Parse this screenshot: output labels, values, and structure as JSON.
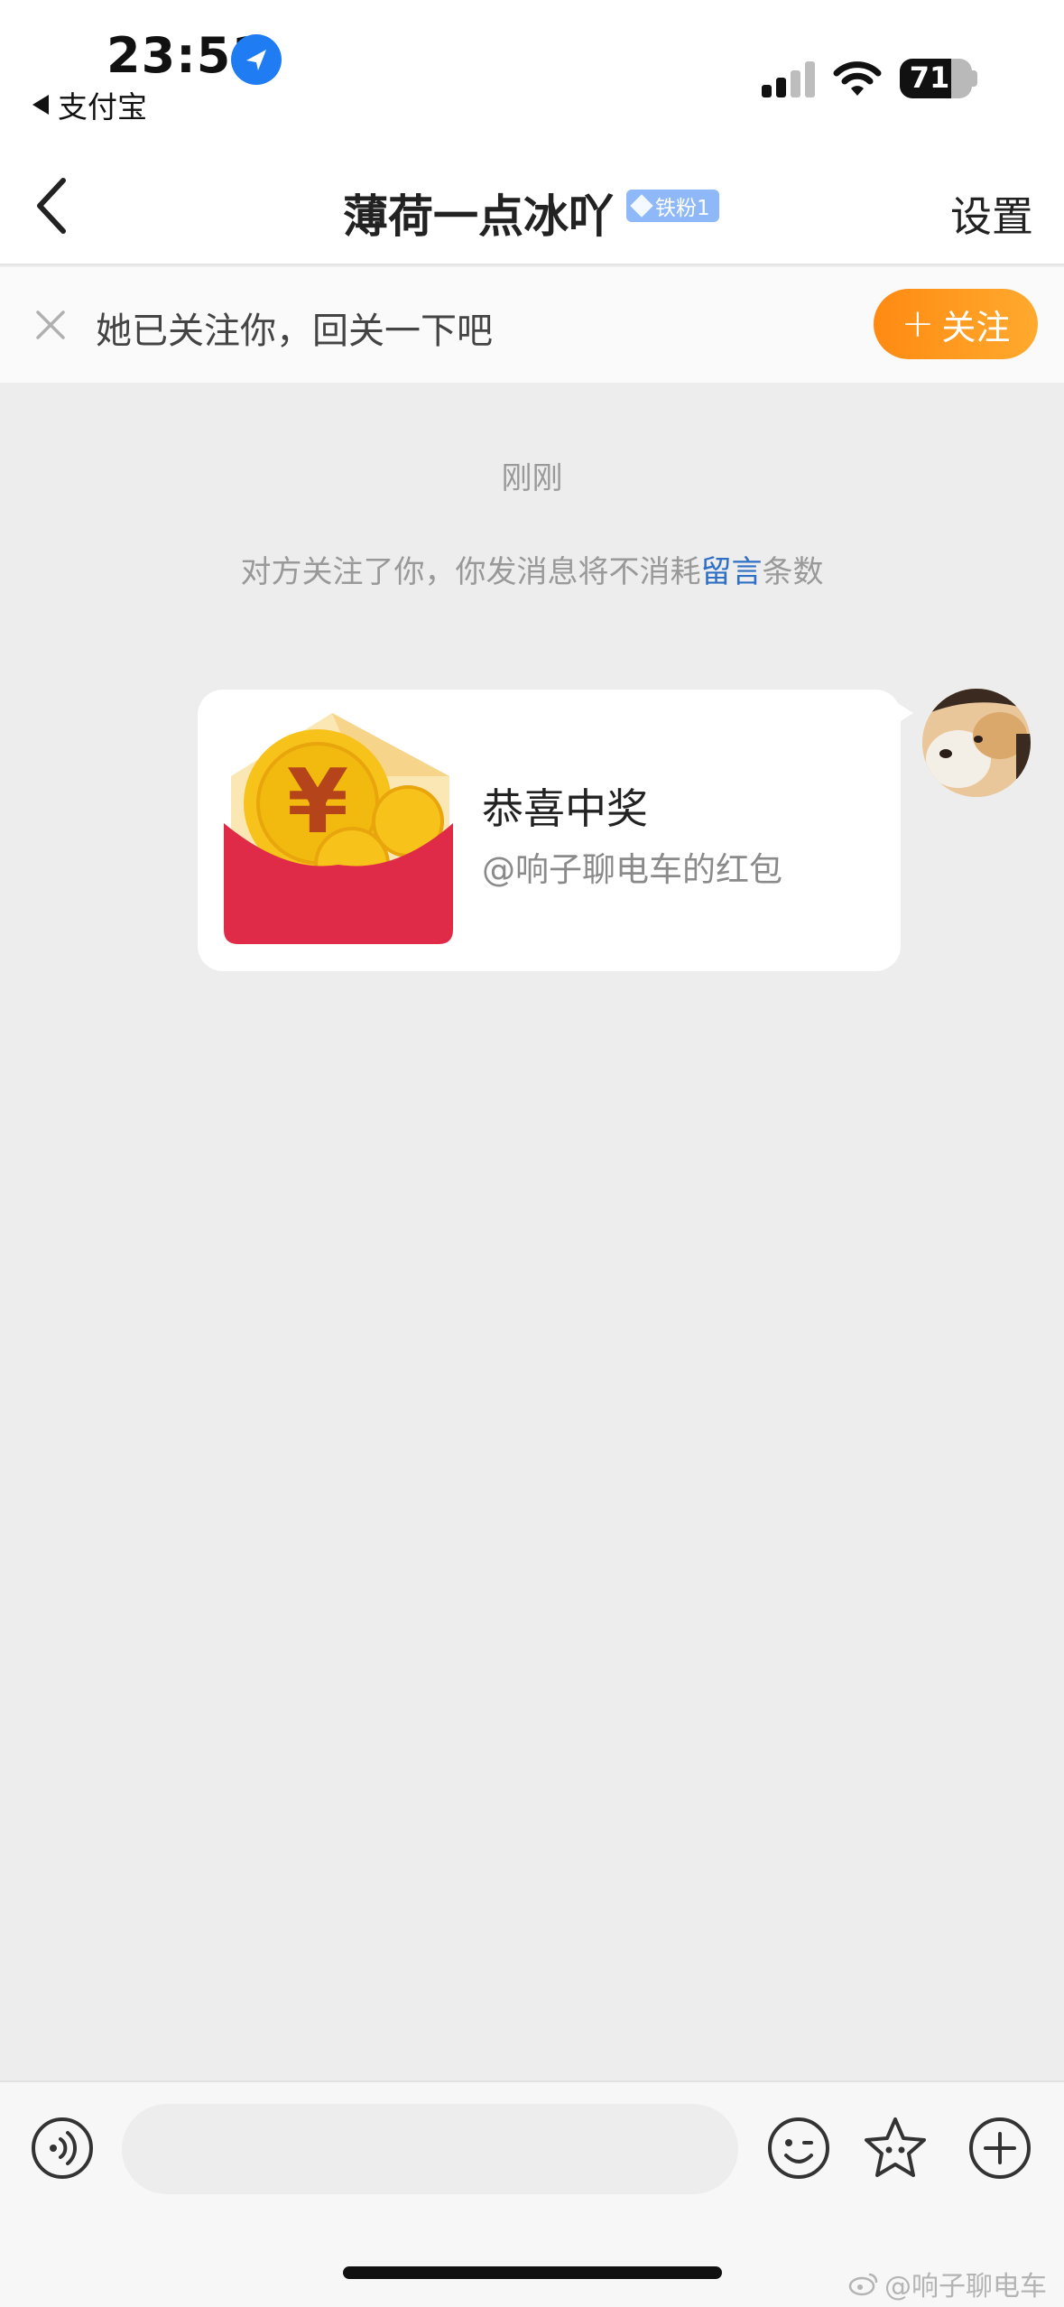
{
  "status_bar": {
    "time": "23:51",
    "back_app": "支付宝",
    "battery": "71",
    "icons": {
      "location": "location-arrow-icon",
      "signal": "cell-signal-icon",
      "wifi": "wifi-icon",
      "battery": "battery-icon"
    }
  },
  "nav": {
    "back_icon": "chevron-left-icon",
    "title": "薄荷一点冰吖",
    "badge": "铁粉1",
    "settings": "设置"
  },
  "banner": {
    "close_icon": "close-icon",
    "text": "她已关注你，回关一下吧",
    "follow_button": "关注",
    "follow_button_prefix": "+"
  },
  "chat": {
    "timestamp": "刚刚",
    "notice_prefix": "对方关注了你，你发消息将不消耗",
    "notice_link": "留言",
    "notice_suffix": "条数",
    "message": {
      "type": "red-packet",
      "image_icon": "red-packet-icon",
      "title": "恭喜中奖",
      "subtitle": "@响子聊电车的红包"
    }
  },
  "input_bar": {
    "voice_icon": "voice-icon",
    "text_value": "",
    "emoji_icon": "emoji-icon",
    "sticker_icon": "sticker-star-icon",
    "more_icon": "plus-circle-icon"
  },
  "watermark": "@响子聊电车",
  "colors": {
    "accent_orange": "#ff8a12",
    "link_blue": "#2f6fc6",
    "badge_blue": "#8fb8f8",
    "chat_bg": "#ededed",
    "red_packet_red": "#e02b48",
    "coin_gold": "#f7c21a"
  }
}
